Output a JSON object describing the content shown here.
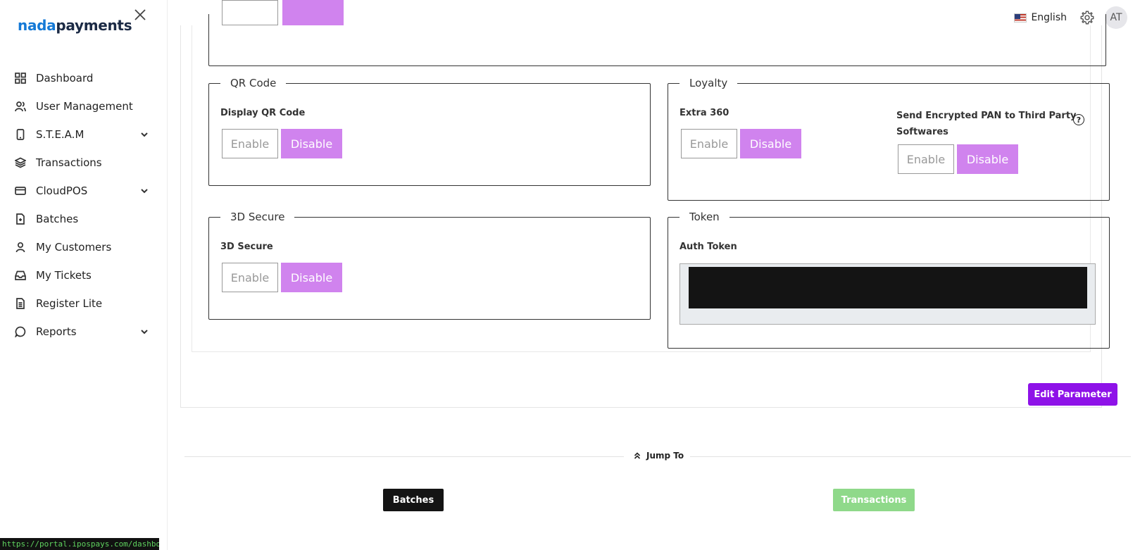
{
  "brand": {
    "part1": "nada",
    "part2": "payments"
  },
  "sidebar": {
    "close_icon": "close-icon",
    "items": [
      {
        "label": "Dashboard",
        "icon": "grid-icon",
        "has_chevron": false
      },
      {
        "label": "User Management",
        "icon": "users-icon",
        "has_chevron": false
      },
      {
        "label": "S.T.E.A.M",
        "icon": "tablet-icon",
        "has_chevron": true
      },
      {
        "label": "Transactions",
        "icon": "layers-icon",
        "has_chevron": false
      },
      {
        "label": "CloudPOS",
        "icon": "card-icon",
        "has_chevron": true
      },
      {
        "label": "Batches",
        "icon": "file-icon",
        "has_chevron": false
      },
      {
        "label": "My Customers",
        "icon": "user-icon",
        "has_chevron": false
      },
      {
        "label": "My Tickets",
        "icon": "inbox-icon",
        "has_chevron": false
      },
      {
        "label": "Register Lite",
        "icon": "document-icon",
        "has_chevron": false
      },
      {
        "label": "Reports",
        "icon": "chat-icon",
        "has_chevron": true
      }
    ]
  },
  "header": {
    "language": "English",
    "avatar_initials": "AT"
  },
  "buttons": {
    "enable": "Enable",
    "disable": "Disable"
  },
  "qr_code": {
    "legend": "QR Code",
    "label": "Display QR Code"
  },
  "loyalty": {
    "legend": "Loyalty",
    "extra_label": "Extra 360",
    "pan_label_1": "Send Encrypted PAN to Third Party",
    "pan_label_2": "Softwares",
    "help": "?"
  },
  "secure": {
    "legend": "3D Secure",
    "label": "3D Secure"
  },
  "token": {
    "legend": "Token",
    "label": "Auth Token"
  },
  "edit_parameter": "Edit Parameter",
  "jump_to": {
    "label": "Jump To",
    "batches": "Batches",
    "transactions": "Transactions"
  },
  "colors": {
    "disable_bg": "#d083ee",
    "edit_btn": "#8e12e8",
    "batches_btn": "#141414",
    "transactions_btn": "#8fd98a"
  },
  "status_url": "https://portal.ipospays.com/dashboardv2"
}
